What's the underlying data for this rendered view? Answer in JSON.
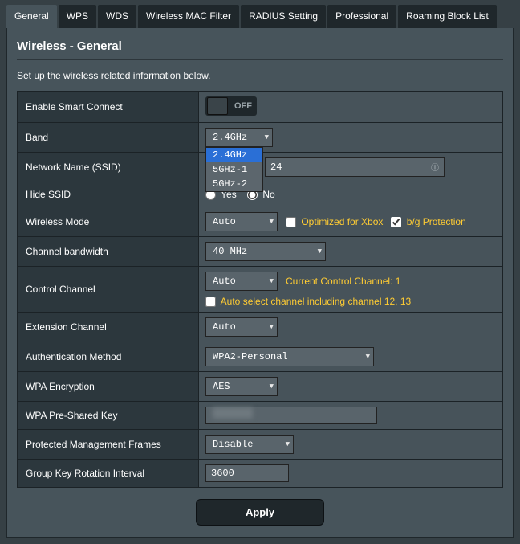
{
  "tabs": [
    {
      "label": "General",
      "active": true
    },
    {
      "label": "WPS",
      "active": false
    },
    {
      "label": "WDS",
      "active": false
    },
    {
      "label": "Wireless MAC Filter",
      "active": false
    },
    {
      "label": "RADIUS Setting",
      "active": false
    },
    {
      "label": "Professional",
      "active": false
    },
    {
      "label": "Roaming Block List",
      "active": false
    }
  ],
  "page": {
    "title": "Wireless - General",
    "subtitle": "Set up the wireless related information below."
  },
  "form": {
    "smart_connect": {
      "label": "Enable Smart Connect",
      "state_text": "OFF",
      "on": false
    },
    "band": {
      "label": "Band",
      "selected": "2.4GHz",
      "options": [
        "2.4GHz",
        "5GHz-1",
        "5GHz-2"
      ],
      "highlight_index": 0
    },
    "ssid": {
      "label": "Network Name (SSID)",
      "value_suffix": "24"
    },
    "hide_ssid": {
      "label": "Hide SSID",
      "yes": "Yes",
      "no": "No",
      "selected": "No"
    },
    "wireless_mode": {
      "label": "Wireless Mode",
      "value": "Auto",
      "opt_xbox": "Optimized for Xbox",
      "opt_bg": "b/g Protection",
      "xbox_checked": false,
      "bg_checked": true
    },
    "channel_bw": {
      "label": "Channel bandwidth",
      "value": "40 MHz"
    },
    "control_channel": {
      "label": "Control Channel",
      "value": "Auto",
      "status": "Current Control Channel: 1",
      "checkbox_label": "Auto select channel including channel 12, 13",
      "checkbox_checked": false
    },
    "ext_channel": {
      "label": "Extension Channel",
      "value": "Auto"
    },
    "auth_method": {
      "label": "Authentication Method",
      "value": "WPA2-Personal"
    },
    "wpa_enc": {
      "label": "WPA Encryption",
      "value": "AES"
    },
    "wpa_psk": {
      "label": "WPA Pre-Shared Key"
    },
    "pmf": {
      "label": "Protected Management Frames",
      "value": "Disable"
    },
    "gk_interval": {
      "label": "Group Key Rotation Interval",
      "value": "3600"
    }
  },
  "apply_label": "Apply"
}
